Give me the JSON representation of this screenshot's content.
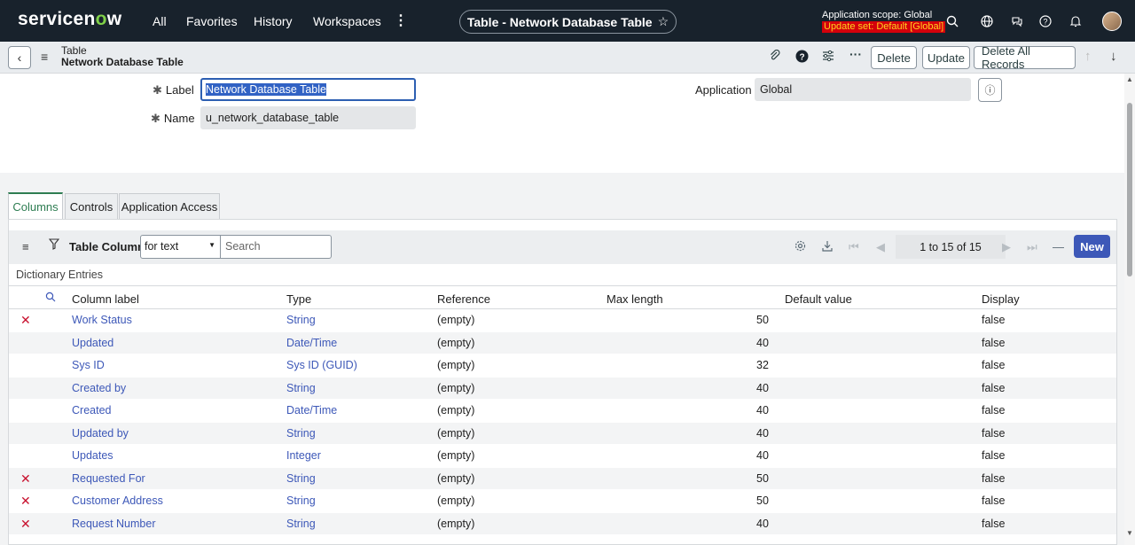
{
  "topnav": {
    "logo_pre": "servicen",
    "logo_o": "o",
    "logo_post": "w",
    "menu": [
      "All",
      "Favorites",
      "History",
      "Workspaces"
    ],
    "more_icon": "more-vertical-icon",
    "record_title": "Table - Network Database Table",
    "star_glyph": "☆",
    "scope_label": "Application scope: Global",
    "update_set": "Update set: Default [Global]",
    "icons": [
      "search-icon",
      "globe-icon",
      "chat-icon",
      "help-icon",
      "bell-icon"
    ]
  },
  "header": {
    "type": "Table",
    "name": "Network Database Table",
    "buttons": {
      "delete": "Delete",
      "update": "Update",
      "delete_all": "Delete All Records"
    }
  },
  "form": {
    "label_label": "Label",
    "label_value": "Network Database Table",
    "name_label": "Name",
    "name_value": "u_network_database_table",
    "application_label": "Application",
    "application_value": "Global",
    "required_glyph": "✱"
  },
  "tabs": [
    "Columns",
    "Controls",
    "Application Access"
  ],
  "list": {
    "title": "Table Columns",
    "filter_select": "for text",
    "search_placeholder": "Search",
    "pagination": "1  to 15 of 15",
    "new_label": "New",
    "section_label": "Dictionary Entries",
    "columns": [
      "Column label",
      "Type",
      "Reference",
      "Max length",
      "Default value",
      "Display"
    ],
    "rows": [
      {
        "deletable": true,
        "label": "Work Status",
        "type": "String",
        "reference": "(empty)",
        "max_length": "50",
        "default": "",
        "display": "false"
      },
      {
        "deletable": false,
        "label": "Updated",
        "type": "Date/Time",
        "reference": "(empty)",
        "max_length": "40",
        "default": "",
        "display": "false"
      },
      {
        "deletable": false,
        "label": "Sys ID",
        "type": "Sys ID (GUID)",
        "reference": "(empty)",
        "max_length": "32",
        "default": "",
        "display": "false"
      },
      {
        "deletable": false,
        "label": "Created by",
        "type": "String",
        "reference": "(empty)",
        "max_length": "40",
        "default": "",
        "display": "false"
      },
      {
        "deletable": false,
        "label": "Created",
        "type": "Date/Time",
        "reference": "(empty)",
        "max_length": "40",
        "default": "",
        "display": "false"
      },
      {
        "deletable": false,
        "label": "Updated by",
        "type": "String",
        "reference": "(empty)",
        "max_length": "40",
        "default": "",
        "display": "false"
      },
      {
        "deletable": false,
        "label": "Updates",
        "type": "Integer",
        "reference": "(empty)",
        "max_length": "40",
        "default": "",
        "display": "false"
      },
      {
        "deletable": true,
        "label": "Requested For",
        "type": "String",
        "reference": "(empty)",
        "max_length": "50",
        "default": "",
        "display": "false"
      },
      {
        "deletable": true,
        "label": "Customer Address",
        "type": "String",
        "reference": "(empty)",
        "max_length": "50",
        "default": "",
        "display": "false"
      },
      {
        "deletable": true,
        "label": "Request Number",
        "type": "String",
        "reference": "(empty)",
        "max_length": "40",
        "default": "",
        "display": "false"
      }
    ]
  },
  "colors": {
    "nav_bg": "#18222c",
    "link": "#3d58b8",
    "active_tab": "#2e7d52",
    "delete_x": "#c8102e",
    "update_set_bg": "#d4000b"
  }
}
